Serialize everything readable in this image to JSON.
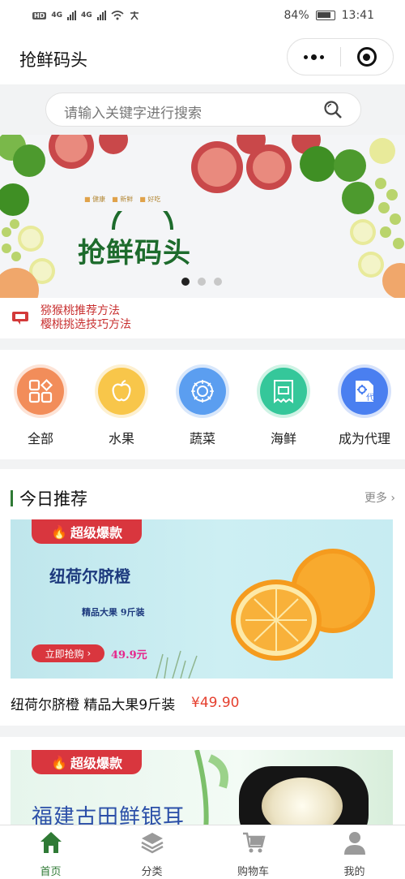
{
  "status_bar": {
    "left_indicators": "HD",
    "net_1": "4G",
    "net_2": "4G",
    "battery": "84%",
    "time": "13:41"
  },
  "nav": {
    "title": "抢鲜码头"
  },
  "search": {
    "placeholder": "请输入关键字进行搜索"
  },
  "banner": {
    "tags": [
      "健康",
      "新鲜",
      "好吃"
    ],
    "logo_text": "抢鲜码头",
    "slide_count": 3,
    "active_slide": 1
  },
  "notice": {
    "lines": [
      "猕猴桃推荐方法",
      "樱桃挑选技巧方法"
    ]
  },
  "categories": [
    {
      "label": "全部",
      "icon": "grid-icon",
      "color": "#f28d5a"
    },
    {
      "label": "水果",
      "icon": "apple-icon",
      "color": "#f8c64a"
    },
    {
      "label": "蔬菜",
      "icon": "sun-icon",
      "color": "#5b9ef0"
    },
    {
      "label": "海鲜",
      "icon": "ticket-icon",
      "color": "#35c79a"
    },
    {
      "label": "成为代理",
      "icon": "agent-icon",
      "color": "#4a7ff0"
    }
  ],
  "recommend": {
    "title": "今日推荐",
    "more": "更多",
    "product1": {
      "badge": "超级爆款",
      "img_title": "纽荷尔脐橙",
      "img_subtitle": "精品大果 9斤装",
      "buy_label": "立即抢购",
      "img_price": "49.9元",
      "name": "纽荷尔脐橙 精品大果9斤装",
      "price": "¥49.90"
    },
    "product2": {
      "badge": "超级爆款",
      "img_title": "福建古田鲜银耳"
    }
  },
  "tabs": [
    {
      "label": "首页",
      "icon": "home-icon",
      "active": true
    },
    {
      "label": "分类",
      "icon": "layers-icon",
      "active": false
    },
    {
      "label": "购物车",
      "icon": "cart-icon",
      "active": false
    },
    {
      "label": "我的",
      "icon": "user-icon",
      "active": false
    }
  ],
  "colors": {
    "primary_green": "#2f7a35",
    "badge_red": "#d9363e",
    "price_red": "#e5402f"
  }
}
